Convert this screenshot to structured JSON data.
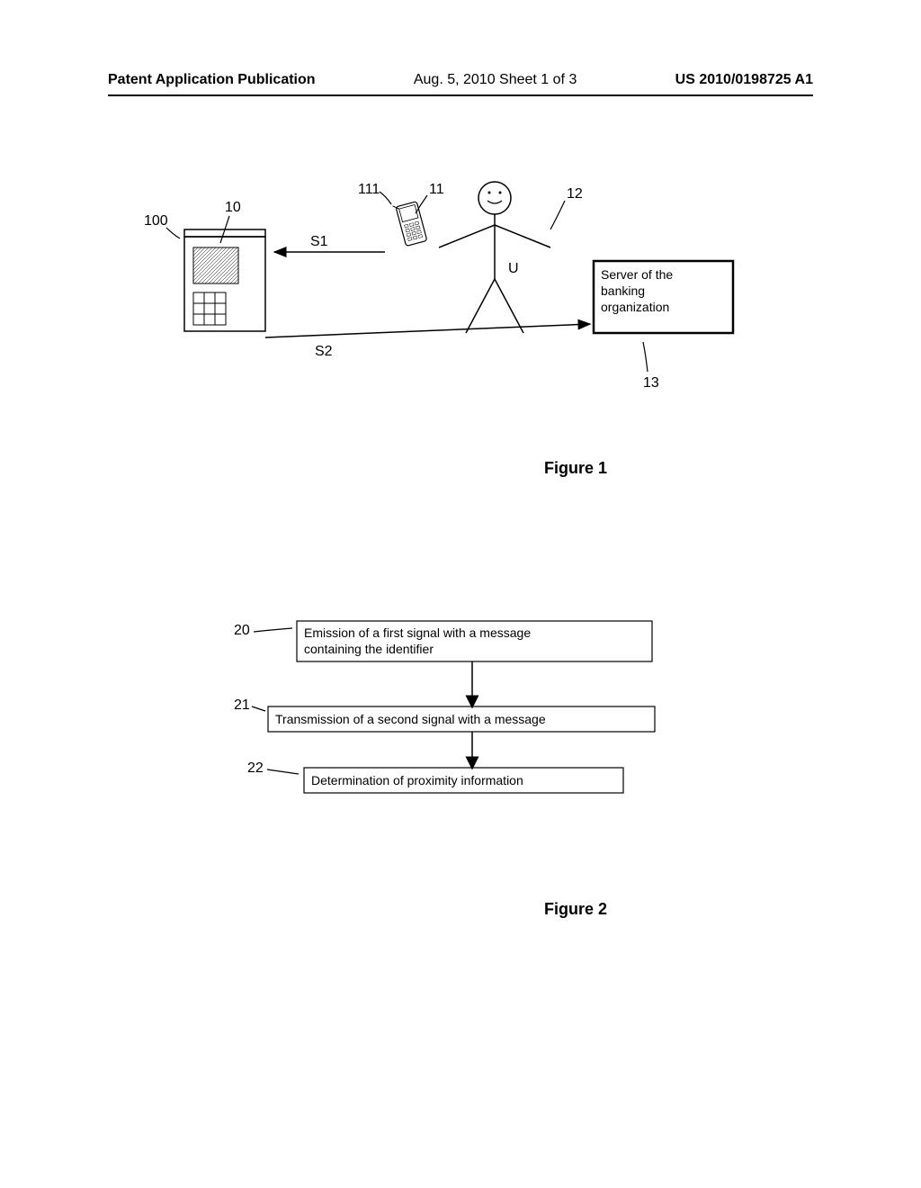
{
  "header": {
    "left": "Patent Application Publication",
    "center": "Aug. 5, 2010  Sheet 1 of 3",
    "right": "US 2010/0198725 A1"
  },
  "figure1": {
    "label": "Figure 1",
    "refs": {
      "r100": "100",
      "r10": "10",
      "r11": "11",
      "r111": "111",
      "r12": "12",
      "r13": "13",
      "u": "U",
      "s1": "S1",
      "s2": "S2"
    },
    "server_box": "Server of the\nbanking\norganization"
  },
  "figure2": {
    "label": "Figure 2",
    "refs": {
      "r20": "20",
      "r21": "21",
      "r22": "22"
    },
    "steps": {
      "s20": "Emission of a first signal with a message\ncontaining the identifier",
      "s21": "Transmission of a second signal with a message",
      "s22": "Determination of proximity information"
    }
  }
}
